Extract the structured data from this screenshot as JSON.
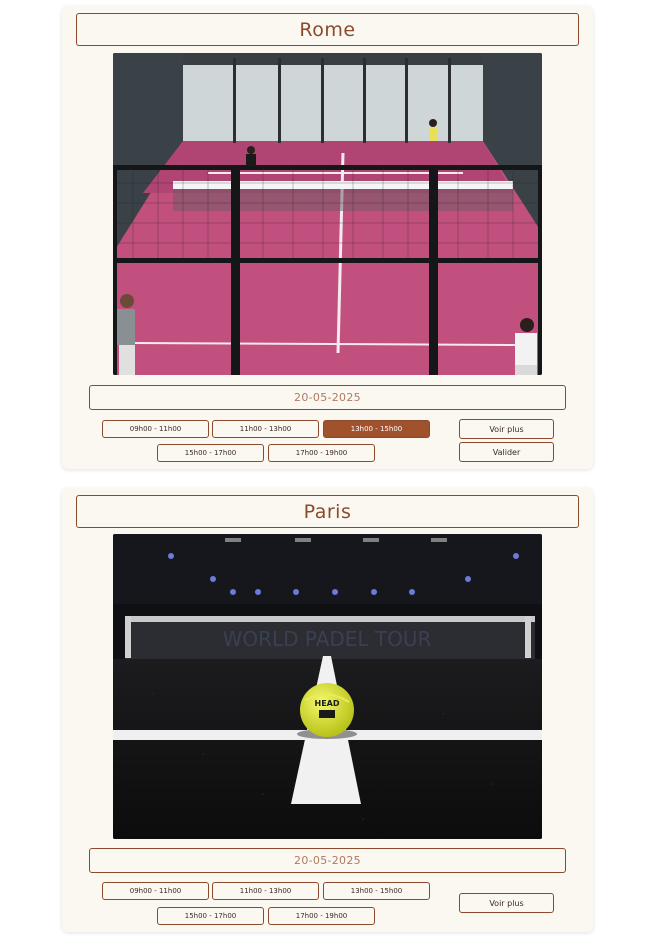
{
  "cards": [
    {
      "city": "Rome",
      "image_name": "padel-court-photo",
      "date": "20-05-2025",
      "slots": [
        "09h00 - 11h00",
        "11h00 - 13h00",
        "13h00 - 15h00",
        "15h00 - 17h00",
        "17h00 - 19h00"
      ],
      "selected_slot": "13h00 - 15h00",
      "voir_plus": "Voir plus",
      "valider": "Valider"
    },
    {
      "city": "Paris",
      "image_name": "padel-ball-photo",
      "date": "20-05-2025",
      "slots": [
        "09h00 - 11h00",
        "11h00 - 13h00",
        "13h00 - 15h00",
        "15h00 - 17h00",
        "17h00 - 19h00"
      ],
      "selected_slot": "",
      "voir_plus": "Voir plus"
    }
  ],
  "colors": {
    "accent": "#8b4a2b",
    "selected": "#a0522d",
    "card_bg": "#fbf8f1",
    "court_pink": "#c2507e"
  }
}
